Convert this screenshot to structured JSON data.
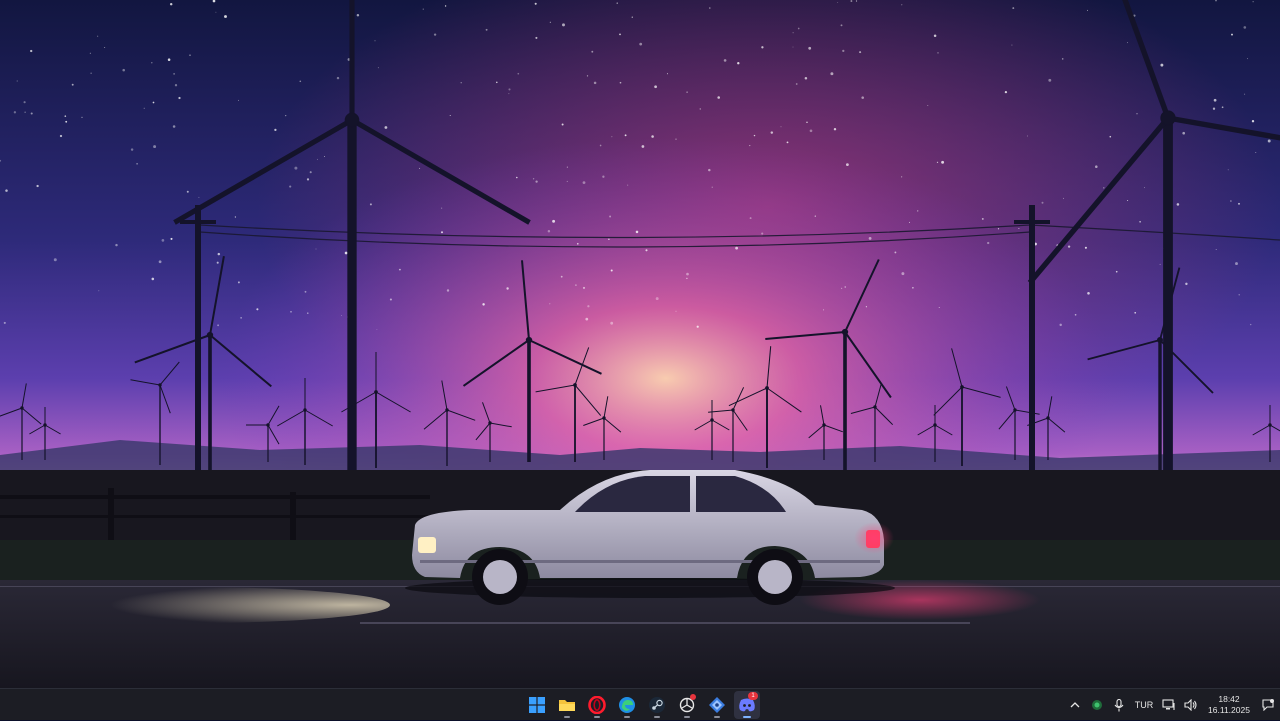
{
  "desktop": {
    "wallpaper": "night-wind-farm-car-wallpaper",
    "colors": {
      "sky_top": "#141a44",
      "sky_mid": "#3b2f8f",
      "glow": "#e04a8c",
      "horizon": "#ffd7a8",
      "ground": "#15141d"
    }
  },
  "taskbar": {
    "apps": [
      {
        "name": "start-button",
        "icon": "windows-logo-icon"
      },
      {
        "name": "file-explorer",
        "icon": "folder-icon"
      },
      {
        "name": "opera-browser",
        "icon": "opera-icon"
      },
      {
        "name": "microsoft-edge",
        "icon": "edge-icon"
      },
      {
        "name": "steam",
        "icon": "steam-icon"
      },
      {
        "name": "chatgpt",
        "icon": "chatgpt-icon"
      },
      {
        "name": "app-diamond",
        "icon": "diamond-icon"
      },
      {
        "name": "discord",
        "icon": "discord-icon",
        "badge": "1"
      }
    ],
    "tray": {
      "language": "TUR",
      "time": "18:42",
      "date": "16.11.2025",
      "icons": [
        "chevron-up-icon",
        "security-icon",
        "microphone-icon",
        "network-icon",
        "volume-icon",
        "notification-icon"
      ]
    }
  }
}
